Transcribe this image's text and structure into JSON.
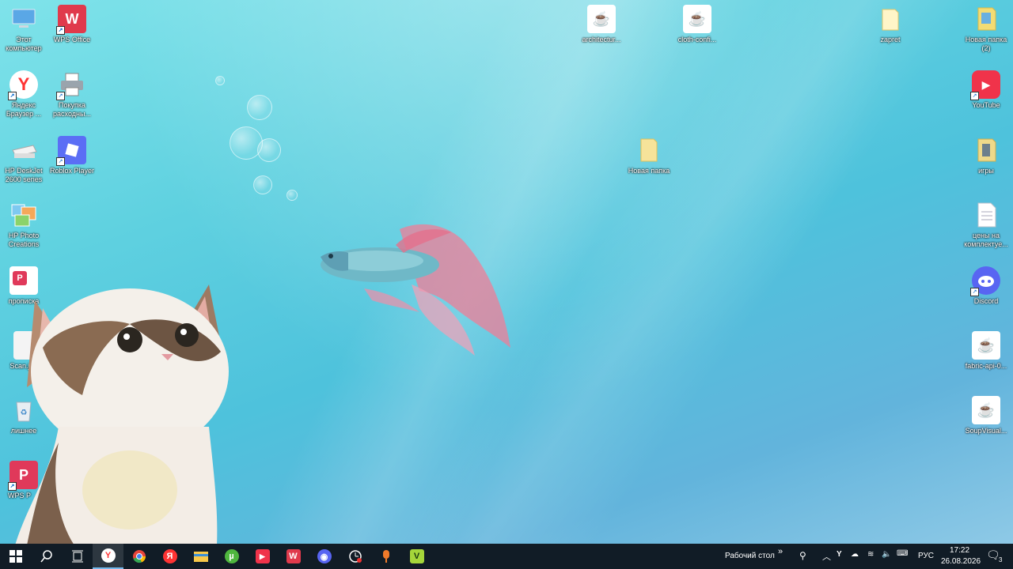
{
  "desktop": {
    "icons_left": [
      {
        "label": "Этот компьютер",
        "icon": "computer-icon"
      },
      {
        "label": "WPS Office",
        "icon": "wps-office-icon"
      },
      {
        "label": "Яндекс Браузер ...",
        "icon": "yandex-browser-icon"
      },
      {
        "label": "Покупка расходны...",
        "icon": "printer-icon"
      },
      {
        "label": "HP DeskJet 2600 series",
        "icon": "hp-printer-icon"
      },
      {
        "label": "Roblox Player",
        "icon": "roblox-icon"
      },
      {
        "label": "HP Photo Creations",
        "icon": "hp-photo-icon"
      },
      {
        "label": "прописка",
        "icon": "wps-pdf-icon"
      },
      {
        "label": "Scan.jpg",
        "icon": "image-file-icon"
      },
      {
        "label": "лишнее",
        "icon": "recycle-bin-icon"
      },
      {
        "label": "WPS P",
        "icon": "wps-pdf-icon"
      }
    ],
    "icons_right": [
      {
        "label": "architectur...",
        "icon": "java-file-icon"
      },
      {
        "label": "cloth-confi...",
        "icon": "java-file-icon"
      },
      {
        "label": "zapret",
        "icon": "folder-icon"
      },
      {
        "label": "Новая папка (2)",
        "icon": "folder-icon"
      },
      {
        "label": "YouTube",
        "icon": "youtube-icon"
      },
      {
        "label": "Новая папка",
        "icon": "folder-icon"
      },
      {
        "label": "игры",
        "icon": "folder-icon"
      },
      {
        "label": "цены на комплектуе...",
        "icon": "text-file-icon"
      },
      {
        "label": "Discord",
        "icon": "discord-icon"
      },
      {
        "label": "fabric-api-0...",
        "icon": "java-file-icon"
      },
      {
        "label": "SoupVisual...",
        "icon": "java-file-icon"
      }
    ]
  },
  "taskbar": {
    "apps": [
      "start-icon",
      "search-icon",
      "task-view-icon",
      "yandex-browser-icon",
      "chrome-icon",
      "yandex-icon",
      "file-explorer-icon",
      "utorrent-icon",
      "youtube-icon",
      "wps-office-icon",
      "discord-badge-icon",
      "clock-app-icon",
      "microphone-icon",
      "vpn-icon"
    ],
    "desktop_label": "Рабочий стол",
    "language": "РУС",
    "time": "17:22",
    "date": "26.08.2026",
    "notification_count": "3"
  },
  "colors": {
    "taskbar": "#111c26",
    "accent": "#76b9ed"
  }
}
